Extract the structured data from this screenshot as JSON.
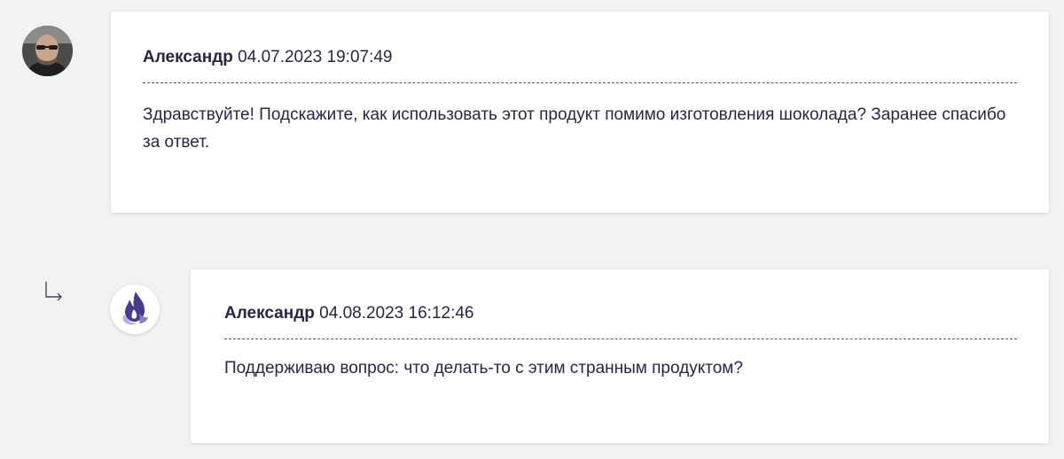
{
  "comments": [
    {
      "author": "Александр",
      "date": "04.07.2023 19:07:49",
      "text": "Здравствуйте! Подскажите, как использовать этот продукт помимо изготовления шоколада? Заранее спасибо за ответ.",
      "avatar_icon": "user-photo"
    },
    {
      "author": "Александр",
      "date": "04.08.2023 16:12:46",
      "text": "Поддерживаю вопрос: что делать-то с этим странным продуктом?",
      "avatar_icon": "brand-flame-logo"
    }
  ],
  "reply_icon": "reply-arrow-icon",
  "colors": {
    "background": "#f2f2f2",
    "text": "#2b2447",
    "brand_purple": "#4a3a8c",
    "brand_light": "#b9aee0"
  }
}
